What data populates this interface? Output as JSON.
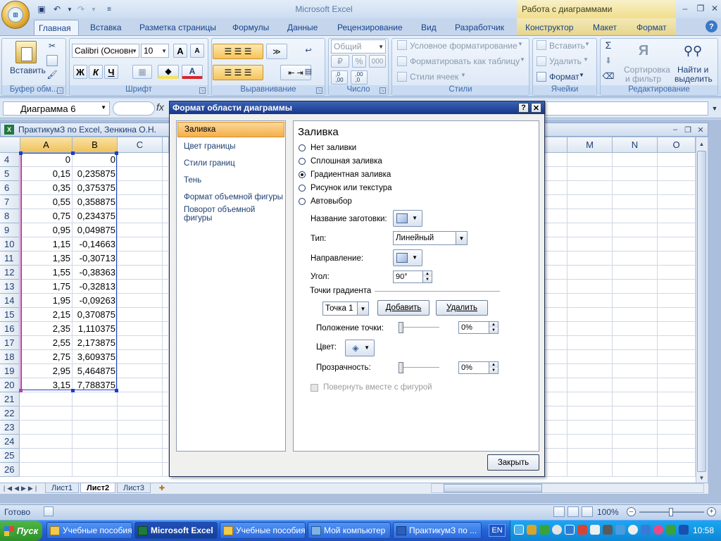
{
  "app": {
    "title": "Microsoft Excel",
    "context_group": "Работа с диаграммами"
  },
  "ribbon": {
    "tabs": [
      "Главная",
      "Вставка",
      "Разметка страницы",
      "Формулы",
      "Данные",
      "Рецензирование",
      "Вид",
      "Разработчик",
      "Конструктор",
      "Макет",
      "Формат"
    ],
    "active_tab": "Главная",
    "groups": {
      "clipboard": {
        "label": "Буфер обм...",
        "paste": "Вставить"
      },
      "font": {
        "label": "Шрифт",
        "font_name": "Calibri (Основн",
        "font_size": "10",
        "bold": "Ж",
        "italic": "К",
        "underline": "Ч",
        "grow": "A",
        "shrink": "A"
      },
      "alignment": {
        "label": "Выравнивание"
      },
      "number": {
        "label": "Число",
        "format": "Общий",
        "percent": "%",
        "thousands": "000",
        "inc_dec": ",0\n,00",
        "dec_dec": ",00\n,0"
      },
      "styles": {
        "label": "Стили",
        "cond": "Условное форматирование",
        "table": "Форматировать как таблицу",
        "cell": "Стили ячеек"
      },
      "cells": {
        "label": "Ячейки",
        "insert": "Вставить",
        "delete": "Удалить",
        "format": "Формат"
      },
      "editing": {
        "label": "Редактирование",
        "sigma": "Σ",
        "sort": "Сортировка",
        "sort2": "и фильтр",
        "find": "Найти и",
        "find2": "выделить"
      }
    }
  },
  "formula_bar": {
    "name_box": "Диаграмма 6",
    "fx": "fx",
    "value": ""
  },
  "workbook": {
    "title": "ПрактикумЗ по Excel, Зенкина О.Н.",
    "columns": [
      "A",
      "B",
      "C",
      "M",
      "N",
      "O"
    ],
    "rows": [
      {
        "n": "4",
        "a": "0",
        "b": "0"
      },
      {
        "n": "5",
        "a": "0,15",
        "b": "0,235875"
      },
      {
        "n": "6",
        "a": "0,35",
        "b": "0,375375"
      },
      {
        "n": "7",
        "a": "0,55",
        "b": "0,358875"
      },
      {
        "n": "8",
        "a": "0,75",
        "b": "0,234375"
      },
      {
        "n": "9",
        "a": "0,95",
        "b": "0,049875"
      },
      {
        "n": "10",
        "a": "1,15",
        "b": "-0,14663"
      },
      {
        "n": "11",
        "a": "1,35",
        "b": "-0,30713"
      },
      {
        "n": "12",
        "a": "1,55",
        "b": "-0,38363"
      },
      {
        "n": "13",
        "a": "1,75",
        "b": "-0,32813"
      },
      {
        "n": "14",
        "a": "1,95",
        "b": "-0,09263"
      },
      {
        "n": "15",
        "a": "2,15",
        "b": "0,370875"
      },
      {
        "n": "16",
        "a": "2,35",
        "b": "1,110375"
      },
      {
        "n": "17",
        "a": "2,55",
        "b": "2,173875"
      },
      {
        "n": "18",
        "a": "2,75",
        "b": "3,609375"
      },
      {
        "n": "19",
        "a": "2,95",
        "b": "5,464875"
      },
      {
        "n": "20",
        "a": "3,15",
        "b": "7,788375"
      },
      {
        "n": "21",
        "a": "",
        "b": ""
      },
      {
        "n": "22",
        "a": "",
        "b": ""
      },
      {
        "n": "23",
        "a": "",
        "b": ""
      },
      {
        "n": "24",
        "a": "",
        "b": ""
      },
      {
        "n": "25",
        "a": "",
        "b": ""
      },
      {
        "n": "26",
        "a": "",
        "b": ""
      }
    ],
    "sheets": [
      "Лист1",
      "Лист2",
      "Лист3"
    ],
    "active_sheet": "Лист2"
  },
  "status": {
    "ready": "Готово",
    "zoom": "100%"
  },
  "dialog": {
    "title": "Формат области диаграммы",
    "help": "?",
    "close_x": "✕",
    "nav": [
      "Заливка",
      "Цвет границы",
      "Стили границ",
      "Тень",
      "Формат объемной фигуры",
      "Поворот объемной фигуры"
    ],
    "active_nav": "Заливка",
    "panel_title": "Заливка",
    "fill_options": [
      "Нет заливки",
      "Сплошная заливка",
      "Градиентная заливка",
      "Рисунок или текстура",
      "Автовыбор"
    ],
    "selected_fill": "Градиентная заливка",
    "preset_label": "Название заготовки:",
    "type_label": "Тип:",
    "type_value": "Линейный",
    "direction_label": "Направление:",
    "angle_label": "Угол:",
    "angle_value": "90°",
    "stops_label": "Точки градиента",
    "stop_value": "Точка 1",
    "add_button": "Добавить",
    "remove_button": "Удалить",
    "position_label": "Положение точки:",
    "position_value": "0%",
    "position_pct": 0,
    "color_label": "Цвет:",
    "transparency_label": "Прозрачность:",
    "transparency_value": "0%",
    "transparency_pct": 0,
    "rotate_label": "Повернуть вместе с фигурой",
    "close_button": "Закрыть"
  },
  "taskbar": {
    "start": "Пуск",
    "tasks": [
      "Учебные пособия",
      "Microsoft Excel",
      "Учебные пособия",
      "Мой компьютер",
      "ПрактикумЗ по ..."
    ],
    "active_task": "Microsoft Excel",
    "lang": "EN",
    "clock": "10:58"
  }
}
